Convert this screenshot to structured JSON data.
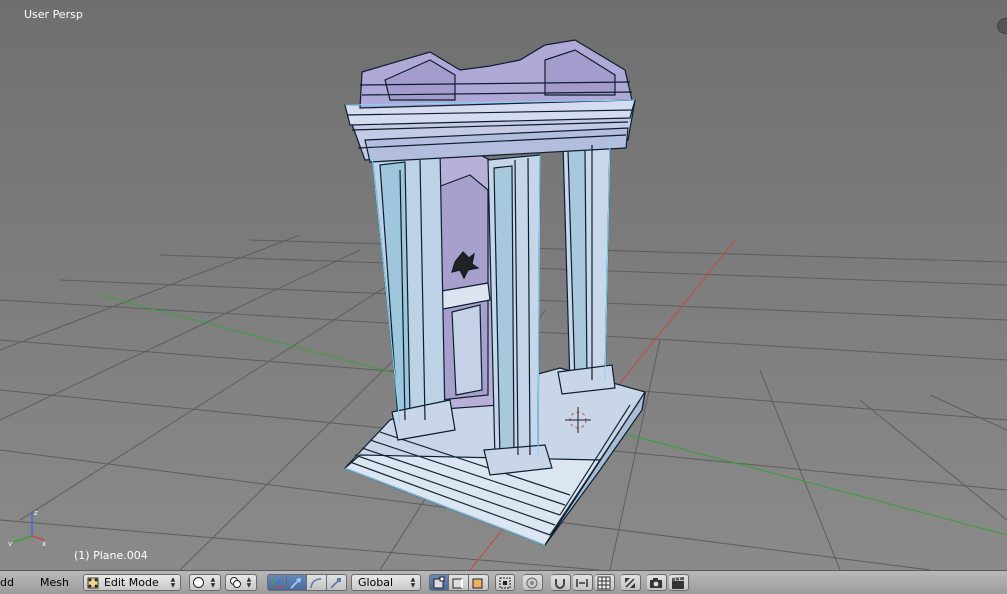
{
  "viewport": {
    "view_name": "User Persp",
    "object_label": "(1) Plane.004"
  },
  "header": {
    "menus": [
      "dd",
      "Mesh"
    ],
    "mode": "Edit Mode",
    "transform_orientation": "Global"
  },
  "icons": {
    "mode": "edit-mode-icon",
    "pivot": "pivot-point-icon",
    "manipulator": "manipulator-icon",
    "translate": "translate-arrow-icon",
    "rotate": "rotate-arc-icon",
    "scale": "scale-icon",
    "vertex_select": "vertex-select-icon",
    "edge_select": "edge-select-icon",
    "face_select": "face-select-icon",
    "render": "render-camera-icon",
    "animation": "clapperboard-icon"
  },
  "colors": {
    "x_axis": "#c44a4a",
    "y_axis": "#3aa03a",
    "z_axis": "#4a6ad0",
    "mesh_wire": "#0c1f2e",
    "mesh_face": "#c8d6e8",
    "mesh_edge_select": "#7fd8ff"
  }
}
